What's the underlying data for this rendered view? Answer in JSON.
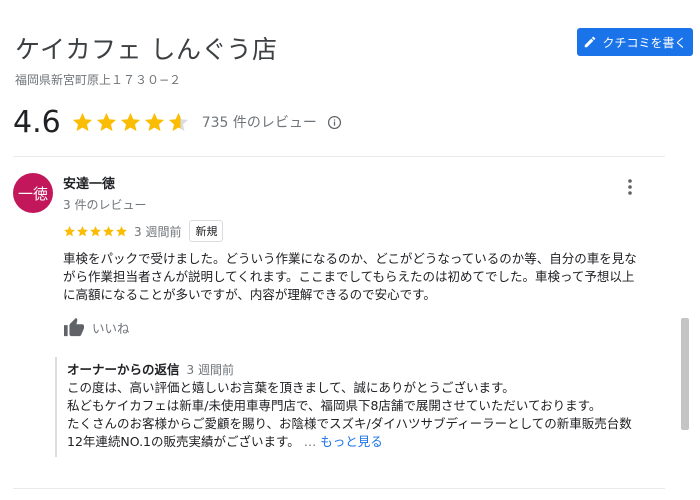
{
  "place": {
    "title": "ケイカフェ しんぐう店",
    "address": "福岡県新宮町原上１７３０−２"
  },
  "actions": {
    "write_review_label": "クチコミを書く"
  },
  "summary": {
    "rating": "4.6",
    "stars": 4.6,
    "review_count_label": "735 件のレビュー"
  },
  "review": {
    "avatar_text": "一徳",
    "reviewer_name": "安達一徳",
    "reviewer_meta": "3 件のレビュー",
    "stars": 5,
    "time_ago": "3 週間前",
    "badge": "新規",
    "text_lines": [
      "車検をパックで受けました。どういう作業になるのか、どこがどうなっているのか等、自分の車を見な",
      "がら作業担当者さんが説明してくれます。ここまでしてもらえたのは初めてでした。車検って予想以上",
      "に高額になることが多いですが、内容が理解できるので安心です。"
    ],
    "like_label": "いいね"
  },
  "owner_reply": {
    "title": "オーナーからの返信",
    "time_ago": "3 週間前",
    "lines": [
      "この度は、高い評価と嬉しいお言葉を頂きまして、誠にありがとうございます。",
      "私どもケイカフェは新車/未使用車専門店で、福岡県下8店舗で展開させていただいております。",
      "たくさんのお客様からご愛顧を賜り、お陰様でスズキ/ダイハツサブディーラーとしての新車販売台数"
    ],
    "last_line": "12年連続NO.1の販売実績がございます。",
    "ellipsis": "…",
    "more_label": "もっと見る"
  },
  "colors": {
    "star": "#fbbc04",
    "accent": "#1a73e8",
    "avatar": "#c2185b"
  },
  "icons": {
    "edit": "pencil-icon",
    "info": "info-icon",
    "more": "more-vert-icon",
    "like": "thumb-up-icon"
  }
}
